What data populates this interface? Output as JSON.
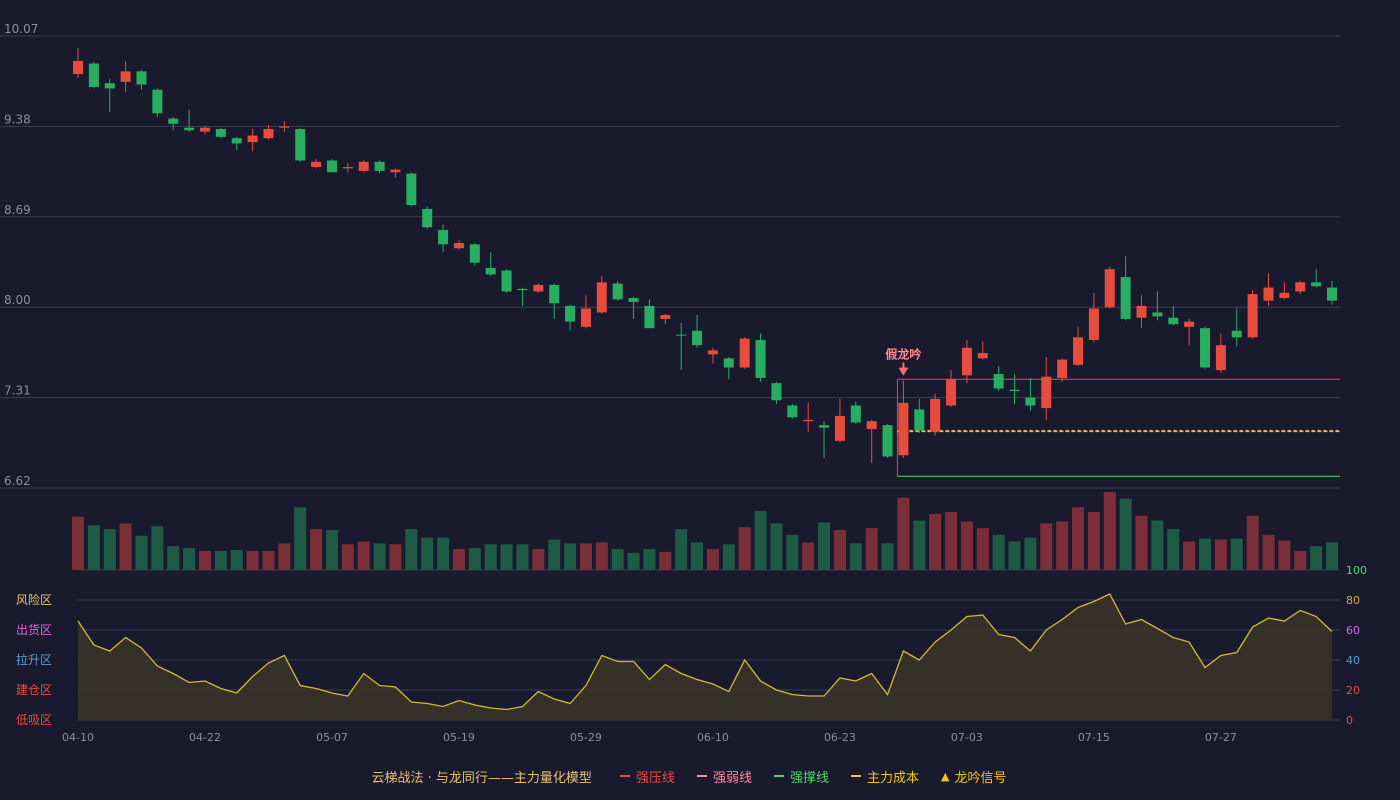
{
  "chart_data": {
    "type": "candlestick",
    "price_axis": {
      "ylim": [
        6.62,
        10.07
      ],
      "ticks": [
        "10.07",
        "9.38",
        "8.69",
        "8.00",
        "7.31",
        "6.62"
      ]
    },
    "x_ticks": [
      {
        "label": "04-10",
        "index": 0
      },
      {
        "label": "04-22",
        "index": 8
      },
      {
        "label": "05-07",
        "index": 16
      },
      {
        "label": "05-19",
        "index": 24
      },
      {
        "label": "05-29",
        "index": 32
      },
      {
        "label": "06-10",
        "index": 40
      },
      {
        "label": "06-23",
        "index": 48
      },
      {
        "label": "07-03",
        "index": 56
      },
      {
        "label": "07-15",
        "index": 64
      },
      {
        "label": "07-27",
        "index": 72
      }
    ],
    "candles": [
      {
        "o": 9.78,
        "c": 9.88,
        "h": 9.98,
        "l": 9.75,
        "dir": "up"
      },
      {
        "o": 9.86,
        "c": 9.68,
        "h": 9.87,
        "l": 9.67,
        "dir": "down"
      },
      {
        "o": 9.71,
        "c": 9.67,
        "h": 9.74,
        "l": 9.49,
        "dir": "down"
      },
      {
        "o": 9.72,
        "c": 9.8,
        "h": 9.88,
        "l": 9.64,
        "dir": "up"
      },
      {
        "o": 9.8,
        "c": 9.7,
        "h": 9.81,
        "l": 9.66,
        "dir": "down"
      },
      {
        "o": 9.66,
        "c": 9.48,
        "h": 9.67,
        "l": 9.45,
        "dir": "down"
      },
      {
        "o": 9.44,
        "c": 9.4,
        "h": 9.45,
        "l": 9.35,
        "dir": "down"
      },
      {
        "o": 9.37,
        "c": 9.35,
        "h": 9.51,
        "l": 9.34,
        "dir": "down"
      },
      {
        "o": 9.34,
        "c": 9.37,
        "h": 9.38,
        "l": 9.32,
        "dir": "up"
      },
      {
        "o": 9.36,
        "c": 9.3,
        "h": 9.37,
        "l": 9.29,
        "dir": "down"
      },
      {
        "o": 9.29,
        "c": 9.25,
        "h": 9.3,
        "l": 9.2,
        "dir": "down"
      },
      {
        "o": 9.26,
        "c": 9.31,
        "h": 9.36,
        "l": 9.19,
        "dir": "up"
      },
      {
        "o": 9.29,
        "c": 9.36,
        "h": 9.39,
        "l": 9.28,
        "dir": "up"
      },
      {
        "o": 9.37,
        "c": 9.38,
        "h": 9.42,
        "l": 9.34,
        "dir": "up"
      },
      {
        "o": 9.36,
        "c": 9.12,
        "h": 9.37,
        "l": 9.11,
        "dir": "down"
      },
      {
        "o": 9.07,
        "c": 9.11,
        "h": 9.13,
        "l": 9.06,
        "dir": "up"
      },
      {
        "o": 9.12,
        "c": 9.03,
        "h": 9.13,
        "l": 9.03,
        "dir": "down"
      },
      {
        "o": 9.06,
        "c": 9.07,
        "h": 9.1,
        "l": 9.03,
        "dir": "up"
      },
      {
        "o": 9.04,
        "c": 9.11,
        "h": 9.12,
        "l": 9.03,
        "dir": "up"
      },
      {
        "o": 9.11,
        "c": 9.04,
        "h": 9.12,
        "l": 9.02,
        "dir": "down"
      },
      {
        "o": 9.03,
        "c": 9.05,
        "h": 9.06,
        "l": 8.99,
        "dir": "up"
      },
      {
        "o": 9.02,
        "c": 8.78,
        "h": 9.03,
        "l": 8.77,
        "dir": "down"
      },
      {
        "o": 8.75,
        "c": 8.61,
        "h": 8.77,
        "l": 8.6,
        "dir": "down"
      },
      {
        "o": 8.59,
        "c": 8.48,
        "h": 8.63,
        "l": 8.42,
        "dir": "down"
      },
      {
        "o": 8.45,
        "c": 8.49,
        "h": 8.51,
        "l": 8.44,
        "dir": "up"
      },
      {
        "o": 8.48,
        "c": 8.34,
        "h": 8.49,
        "l": 8.32,
        "dir": "down"
      },
      {
        "o": 8.3,
        "c": 8.25,
        "h": 8.42,
        "l": 8.24,
        "dir": "down"
      },
      {
        "o": 8.28,
        "c": 8.12,
        "h": 8.29,
        "l": 8.11,
        "dir": "down"
      },
      {
        "o": 8.14,
        "c": 8.13,
        "h": 8.15,
        "l": 8.01,
        "dir": "down"
      },
      {
        "o": 8.12,
        "c": 8.17,
        "h": 8.18,
        "l": 8.11,
        "dir": "up"
      },
      {
        "o": 8.17,
        "c": 8.03,
        "h": 8.18,
        "l": 7.91,
        "dir": "down"
      },
      {
        "o": 8.01,
        "c": 7.89,
        "h": 8.02,
        "l": 7.82,
        "dir": "down"
      },
      {
        "o": 7.85,
        "c": 7.99,
        "h": 8.09,
        "l": 7.84,
        "dir": "up"
      },
      {
        "o": 7.96,
        "c": 8.19,
        "h": 8.24,
        "l": 7.95,
        "dir": "up"
      },
      {
        "o": 8.18,
        "c": 8.06,
        "h": 8.2,
        "l": 8.05,
        "dir": "down"
      },
      {
        "o": 8.07,
        "c": 8.04,
        "h": 8.08,
        "l": 7.91,
        "dir": "down"
      },
      {
        "o": 8.01,
        "c": 7.84,
        "h": 8.06,
        "l": 7.84,
        "dir": "down"
      },
      {
        "o": 7.91,
        "c": 7.94,
        "h": 7.95,
        "l": 7.87,
        "dir": "up"
      },
      {
        "o": 7.79,
        "c": 7.79,
        "h": 7.88,
        "l": 7.52,
        "dir": "down"
      },
      {
        "o": 7.82,
        "c": 7.71,
        "h": 7.94,
        "l": 7.69,
        "dir": "down"
      },
      {
        "o": 7.64,
        "c": 7.67,
        "h": 7.69,
        "l": 7.57,
        "dir": "up"
      },
      {
        "o": 7.61,
        "c": 7.54,
        "h": 7.62,
        "l": 7.45,
        "dir": "down"
      },
      {
        "o": 7.54,
        "c": 7.76,
        "h": 7.77,
        "l": 7.53,
        "dir": "up"
      },
      {
        "o": 7.75,
        "c": 7.46,
        "h": 7.8,
        "l": 7.43,
        "dir": "down"
      },
      {
        "o": 7.42,
        "c": 7.29,
        "h": 7.43,
        "l": 7.26,
        "dir": "down"
      },
      {
        "o": 7.25,
        "c": 7.16,
        "h": 7.26,
        "l": 7.15,
        "dir": "down"
      },
      {
        "o": 7.13,
        "c": 7.14,
        "h": 7.27,
        "l": 7.05,
        "dir": "up"
      },
      {
        "o": 7.1,
        "c": 7.08,
        "h": 7.13,
        "l": 6.85,
        "dir": "down"
      },
      {
        "o": 6.98,
        "c": 7.17,
        "h": 7.3,
        "l": 6.97,
        "dir": "up"
      },
      {
        "o": 7.25,
        "c": 7.12,
        "h": 7.28,
        "l": 7.11,
        "dir": "down"
      },
      {
        "o": 7.07,
        "c": 7.13,
        "h": 7.14,
        "l": 6.81,
        "dir": "up"
      },
      {
        "o": 7.1,
        "c": 6.86,
        "h": 7.11,
        "l": 6.85,
        "dir": "down"
      },
      {
        "o": 6.87,
        "c": 7.27,
        "h": 7.44,
        "l": 6.85,
        "dir": "up"
      },
      {
        "o": 7.22,
        "c": 7.06,
        "h": 7.3,
        "l": 7.04,
        "dir": "down"
      },
      {
        "o": 7.05,
        "c": 7.3,
        "h": 7.34,
        "l": 7.02,
        "dir": "up"
      },
      {
        "o": 7.25,
        "c": 7.45,
        "h": 7.52,
        "l": 7.24,
        "dir": "up"
      },
      {
        "o": 7.48,
        "c": 7.69,
        "h": 7.75,
        "l": 7.42,
        "dir": "up"
      },
      {
        "o": 7.61,
        "c": 7.65,
        "h": 7.74,
        "l": 7.6,
        "dir": "up"
      },
      {
        "o": 7.49,
        "c": 7.38,
        "h": 7.55,
        "l": 7.36,
        "dir": "down"
      },
      {
        "o": 7.37,
        "c": 7.36,
        "h": 7.49,
        "l": 7.26,
        "dir": "down"
      },
      {
        "o": 7.31,
        "c": 7.25,
        "h": 7.46,
        "l": 7.21,
        "dir": "down"
      },
      {
        "o": 7.23,
        "c": 7.47,
        "h": 7.62,
        "l": 7.14,
        "dir": "up"
      },
      {
        "o": 7.46,
        "c": 7.6,
        "h": 7.61,
        "l": 7.43,
        "dir": "up"
      },
      {
        "o": 7.56,
        "c": 7.77,
        "h": 7.85,
        "l": 7.55,
        "dir": "up"
      },
      {
        "o": 7.75,
        "c": 7.99,
        "h": 8.11,
        "l": 7.73,
        "dir": "up"
      },
      {
        "o": 8.0,
        "c": 8.29,
        "h": 8.31,
        "l": 7.99,
        "dir": "up"
      },
      {
        "o": 8.23,
        "c": 7.91,
        "h": 8.39,
        "l": 7.9,
        "dir": "down"
      },
      {
        "o": 7.92,
        "c": 8.01,
        "h": 8.09,
        "l": 7.84,
        "dir": "up"
      },
      {
        "o": 7.96,
        "c": 7.93,
        "h": 8.12,
        "l": 7.9,
        "dir": "down"
      },
      {
        "o": 7.92,
        "c": 7.87,
        "h": 8.01,
        "l": 7.86,
        "dir": "down"
      },
      {
        "o": 7.85,
        "c": 7.89,
        "h": 7.91,
        "l": 7.71,
        "dir": "up"
      },
      {
        "o": 7.84,
        "c": 7.54,
        "h": 7.85,
        "l": 7.53,
        "dir": "down"
      },
      {
        "o": 7.52,
        "c": 7.71,
        "h": 7.8,
        "l": 7.5,
        "dir": "up"
      },
      {
        "o": 7.82,
        "c": 7.77,
        "h": 7.99,
        "l": 7.7,
        "dir": "down"
      },
      {
        "o": 7.77,
        "c": 8.1,
        "h": 8.13,
        "l": 7.76,
        "dir": "up"
      },
      {
        "o": 8.05,
        "c": 8.15,
        "h": 8.26,
        "l": 8.01,
        "dir": "up"
      },
      {
        "o": 8.07,
        "c": 8.11,
        "h": 8.19,
        "l": 8.06,
        "dir": "up"
      },
      {
        "o": 8.12,
        "c": 8.19,
        "h": 8.2,
        "l": 8.1,
        "dir": "up"
      },
      {
        "o": 8.19,
        "c": 8.16,
        "h": 8.29,
        "l": 8.15,
        "dir": "down"
      },
      {
        "o": 8.15,
        "c": 8.05,
        "h": 8.2,
        "l": 8.02,
        "dir": "down"
      }
    ],
    "volume": [
      56,
      47,
      43,
      49,
      36,
      46,
      25,
      23,
      20,
      20,
      21,
      20,
      20,
      28,
      66,
      43,
      42,
      27,
      30,
      28,
      27,
      43,
      34,
      34,
      22,
      23,
      27,
      27,
      27,
      22,
      32,
      28,
      28,
      29,
      22,
      18,
      22,
      19,
      43,
      29,
      22,
      27,
      45,
      62,
      49,
      37,
      29,
      50,
      42,
      28,
      44,
      28,
      76,
      52,
      59,
      61,
      51,
      44,
      37,
      30,
      34,
      49,
      51,
      66,
      61,
      82,
      75,
      57,
      52,
      43,
      30,
      33,
      32,
      33,
      57,
      37,
      31,
      20,
      25,
      29
    ],
    "oscillator": {
      "ylim": [
        0,
        100
      ],
      "ticks": [
        "100",
        "80",
        "60",
        "40",
        "20",
        "0"
      ],
      "zones": [
        "风险区",
        "出货区",
        "拉升区",
        "建仓区",
        "低吸区"
      ],
      "values": [
        66,
        50,
        46,
        55,
        48,
        36,
        31,
        25,
        26,
        21,
        18,
        29,
        38,
        43,
        23,
        21,
        18,
        16,
        31,
        23,
        22,
        12,
        11,
        9,
        13,
        10,
        8,
        7,
        9,
        19,
        14,
        11,
        23,
        43,
        39,
        39,
        27,
        37,
        31,
        27,
        24,
        19,
        40,
        26,
        20,
        17,
        16,
        16,
        28,
        26,
        31,
        17,
        46,
        40,
        52,
        60,
        69,
        70,
        57,
        55,
        46,
        60,
        67,
        75,
        79,
        84,
        64,
        67,
        61,
        55,
        52,
        35,
        43,
        45,
        62,
        68,
        66,
        73,
        69,
        59
      ]
    },
    "signal": {
      "label": "假龙吟",
      "index": 52
    },
    "levels": {
      "strong_resist": 7.45,
      "weak_resist": 7.06,
      "main_cost": 7.06,
      "strong_support": 6.71,
      "start_index": 52
    }
  },
  "legend": {
    "title": "云梯战法 · 与龙同行——主力量化模型",
    "items": [
      {
        "key": "strong_resist",
        "label": "强压线",
        "color": "#e74c3c",
        "style": "solid"
      },
      {
        "key": "weak_resist",
        "label": "强弱线",
        "color": "#ff8aa0",
        "style": "dashed"
      },
      {
        "key": "strong_support",
        "label": "强撑线",
        "color": "#4cd964",
        "style": "solid"
      },
      {
        "key": "main_cost",
        "label": "主力成本",
        "color": "#f5c518",
        "style": "dashed"
      },
      {
        "key": "signal",
        "label": "龙吟信号",
        "color": "#f5c518",
        "style": "triangle"
      }
    ]
  },
  "colors": {
    "up": "#e74c3c",
    "down": "#27ae60",
    "vol_up": "#7a2f38",
    "vol_down": "#1f5a44",
    "osc_line": "#d4b83a",
    "osc_fill": "#3a3428",
    "grid": "#3c3c52",
    "zone_colors": [
      "#e8c26a",
      "#e061e0",
      "#5b9bd5",
      "#e74c3c",
      "#e74c3c"
    ],
    "osc_tick_colors": [
      "#4cd964",
      "#e8a23a",
      "#e061e0",
      "#5b9bd5",
      "#e74c3c",
      "#e74c3c"
    ]
  }
}
